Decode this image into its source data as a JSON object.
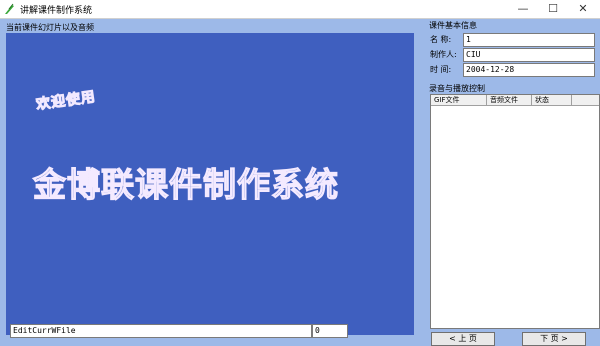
{
  "window": {
    "title": "讲解课件制作系统",
    "minimize_glyph": "—",
    "maximize_glyph": "☐",
    "close_glyph": "✕"
  },
  "left_panel": {
    "group_label": "当前课件幻灯片以及音频",
    "stage": {
      "welcome_text": "欢迎使用",
      "title_text": "金博联课件制作系统"
    },
    "file_field_value": "EditCurrWFile",
    "number_field_value": "0"
  },
  "course_info": {
    "group_label": "课件基本信息",
    "name_label": "名  称:",
    "name_value": "1",
    "author_label": "制作人:",
    "author_value": "CIU",
    "date_label": "时  间:",
    "date_value": "2004-12-28"
  },
  "record_control": {
    "group_label": "录音与播放控制",
    "columns": [
      "GIF文件",
      "音频文件",
      "状态"
    ],
    "prev_button": "<  上 页",
    "next_button": "下 页  >"
  },
  "colors": {
    "stage_background": "#3f5fbf",
    "window_background": "#9db9e8"
  }
}
